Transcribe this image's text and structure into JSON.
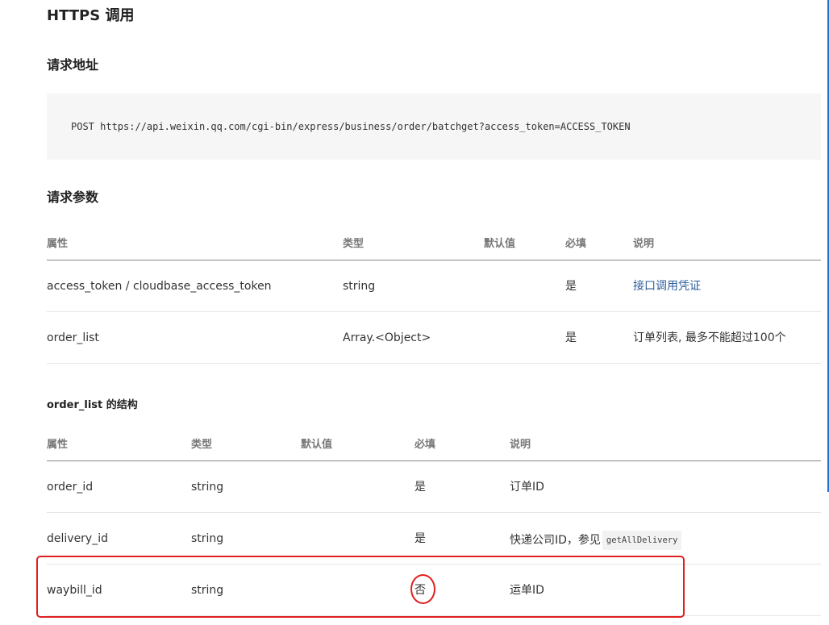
{
  "headings": {
    "https": "HTTPS 调用",
    "request_url": "请求地址",
    "request_params": "请求参数",
    "order_list_structure": "order_list 的结构"
  },
  "request": {
    "code": "POST https://api.weixin.qq.com/cgi-bin/express/business/order/batchget?access_token=ACCESS_TOKEN"
  },
  "params_table": {
    "headers": [
      "属性",
      "类型",
      "默认值",
      "必填",
      "说明"
    ],
    "rows": [
      {
        "name": "access_token / cloudbase_access_token",
        "type": "string",
        "default": "",
        "required": "是",
        "desc": "接口调用凭证"
      },
      {
        "name": "order_list",
        "type": "Array.<Object>",
        "default": "",
        "required": "是",
        "desc": "订单列表, 最多不能超过100个"
      }
    ]
  },
  "order_list_table": {
    "headers": [
      "属性",
      "类型",
      "默认值",
      "必填",
      "说明"
    ],
    "rows": [
      {
        "name": "order_id",
        "type": "string",
        "default": "",
        "required": "是",
        "desc": "订单ID",
        "desc_code": ""
      },
      {
        "name": "delivery_id",
        "type": "string",
        "default": "",
        "required": "是",
        "desc": "快递公司ID，参见",
        "desc_code": "getAllDelivery"
      },
      {
        "name": "waybill_id",
        "type": "string",
        "default": "",
        "required": "否",
        "desc": "运单ID",
        "desc_code": ""
      }
    ]
  },
  "colors": {
    "annotation": "#e02020",
    "link": "#2a5c9a",
    "code_bg": "#f6f6f6"
  }
}
